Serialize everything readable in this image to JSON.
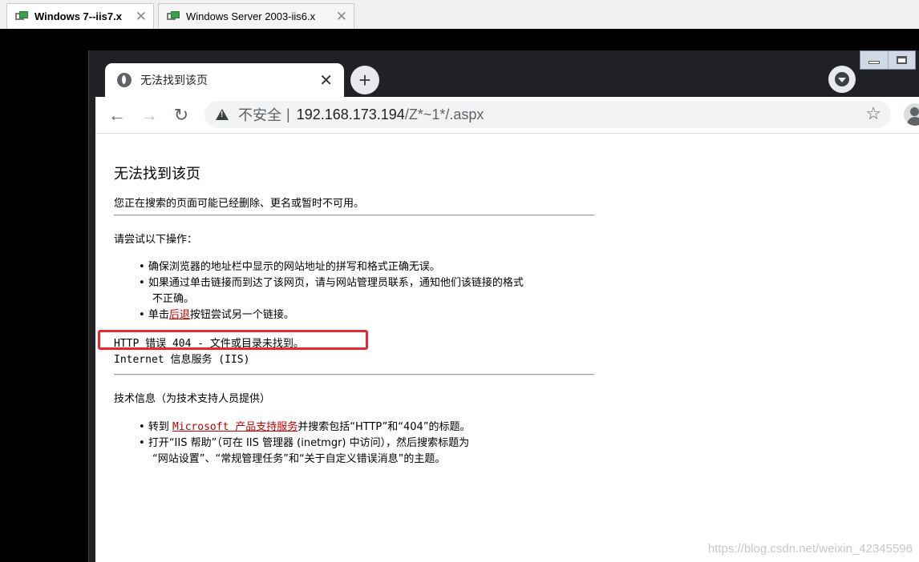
{
  "vm_tabs": [
    {
      "label": "Windows 7--iis7.x",
      "active": true
    },
    {
      "label": "Windows Server 2003-iis6.x",
      "active": false
    }
  ],
  "browser": {
    "tab_title": "无法找到该页",
    "tab_close": "✕",
    "new_tab": "+",
    "omnibox": {
      "security_label": "不安全",
      "separator": "|",
      "url_host": "192.168.173.194",
      "url_path": "/Z*~1*/.aspx"
    }
  },
  "error_page": {
    "title": "无法找到该页",
    "intro": "您正在搜索的页面可能已经删除、更名或暂时不可用。",
    "try_heading": "请尝试以下操作：",
    "try_items": [
      "确保浏览器的地址栏中显示的网站地址的拼写和格式正确无误。",
      "如果通过单击链接而到达了该网页，请与网站管理员联系，通知他们该链接的格式",
      "不正确。"
    ],
    "back_item_prefix": "单击",
    "back_link": "后退",
    "back_item_suffix": "按钮尝试另一个链接。",
    "http_error": "HTTP 错误 404 - 文件或目录未找到。",
    "server": "Internet 信息服务 (IIS)",
    "tech_heading": "技术信息（为技术支持人员提供）",
    "tech_item1_prefix": "转到 ",
    "tech_item1_link": "Microsoft 产品支持服务",
    "tech_item1_suffix": "并搜索包括“HTTP”和“404”的标题。",
    "tech_item2_line1": "打开“IIS 帮助”（可在 IIS 管理器 (inetmgr) 中访问），然后搜索标题为",
    "tech_item2_line2": "“网站设置”、“常规管理任务”和“关于自定义错误消息”的主题。"
  },
  "watermark": "https://blog.csdn.net/weixin_42345596",
  "colors": {
    "highlight_box": "#e8272e",
    "link": "#c00000",
    "vm_icon_green": "#3aa04a"
  },
  "icons": [
    "vm-icon",
    "globe-icon",
    "close-icon",
    "plus-icon",
    "tab-search-icon",
    "back-arrow-icon",
    "forward-arrow-icon",
    "reload-icon",
    "warning-icon",
    "star-icon",
    "avatar-icon",
    "minimize-icon",
    "maximize-icon"
  ]
}
